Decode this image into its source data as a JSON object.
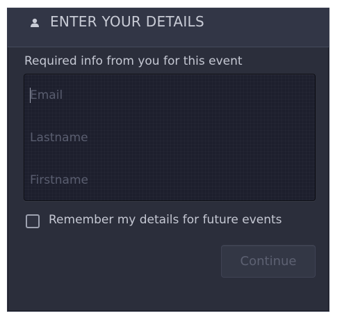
{
  "header": {
    "icon": "user-icon",
    "title": "ENTER YOUR DETAILS"
  },
  "form": {
    "required_text": "Required info from you for this event",
    "fields": [
      {
        "name": "email",
        "placeholder": "Email",
        "value": ""
      },
      {
        "name": "lastname",
        "placeholder": "Lastname",
        "value": ""
      },
      {
        "name": "firstname",
        "placeholder": "Firstname",
        "value": ""
      }
    ],
    "remember_label": "Remember my details for future events",
    "remember_checked": false,
    "continue_label": "Continue",
    "continue_enabled": false
  },
  "colors": {
    "panel_bg": "#2b2e3b",
    "fields_bg": "#1d1f2d",
    "text": "#c5c8d3",
    "placeholder": "#5a5e70"
  }
}
